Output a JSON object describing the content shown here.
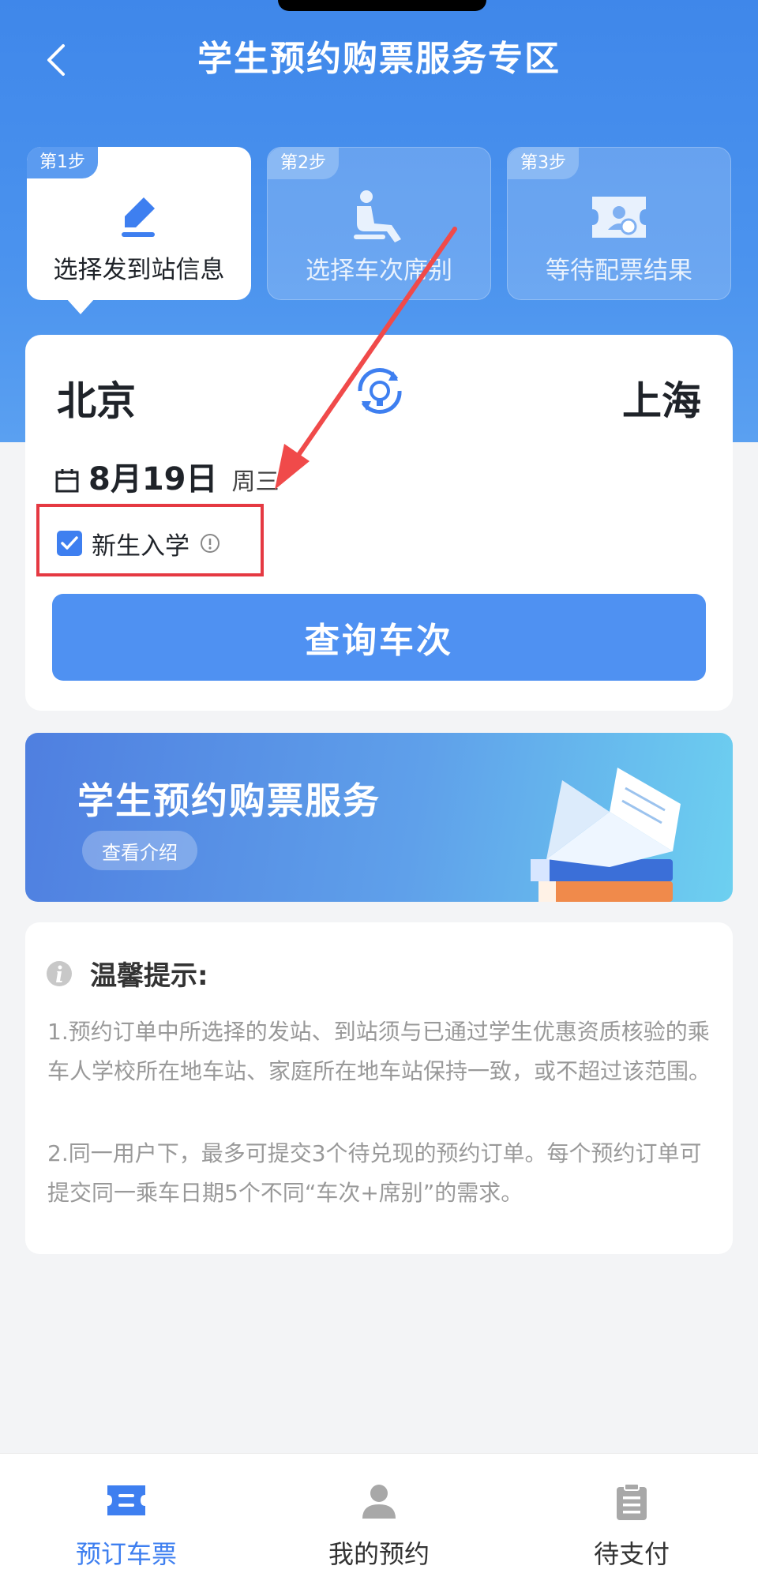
{
  "header": {
    "title": "学生预约购票服务专区",
    "back_icon": "chevron-left-icon"
  },
  "steps": [
    {
      "tag": "第1步",
      "label": "选择发到站信息",
      "icon": "edit-icon",
      "active": true
    },
    {
      "tag": "第2步",
      "label": "选择车次席别",
      "icon": "seat-icon",
      "active": false
    },
    {
      "tag": "第3步",
      "label": "等待配票结果",
      "icon": "ticket-icon",
      "active": false
    }
  ],
  "search": {
    "from": "北京",
    "to": "上海",
    "swap_icon": "swap-icon",
    "date": "8月19日",
    "weekday": "周三",
    "freshman_label": "新生入学",
    "freshman_checked": true,
    "query_button": "查询车次"
  },
  "banner": {
    "title": "学生预约购票服务",
    "button": "查看介绍"
  },
  "tips": {
    "title": "温馨提示:",
    "items": [
      "1.预约订单中所选择的发站、到站须与已通过学生优惠资质核验的乘车人学校所在地车站、家庭所在地车站保持一致，或不超过该范围。",
      "2.同一用户下，最多可提交3个待兑现的预约订单。每个预约订单可提交同一乘车日期5个不同“车次+席别”的需求。"
    ]
  },
  "tabbar": [
    {
      "label": "预订车票",
      "icon": "ticket-tab-icon",
      "active": true
    },
    {
      "label": "我的预约",
      "icon": "user-tab-icon",
      "active": false
    },
    {
      "label": "待支付",
      "icon": "clipboard-tab-icon",
      "active": false
    }
  ],
  "colors": {
    "primary": "#4f91f2",
    "highlight": "#e53942",
    "annotation_arrow": "#f04a4a"
  }
}
